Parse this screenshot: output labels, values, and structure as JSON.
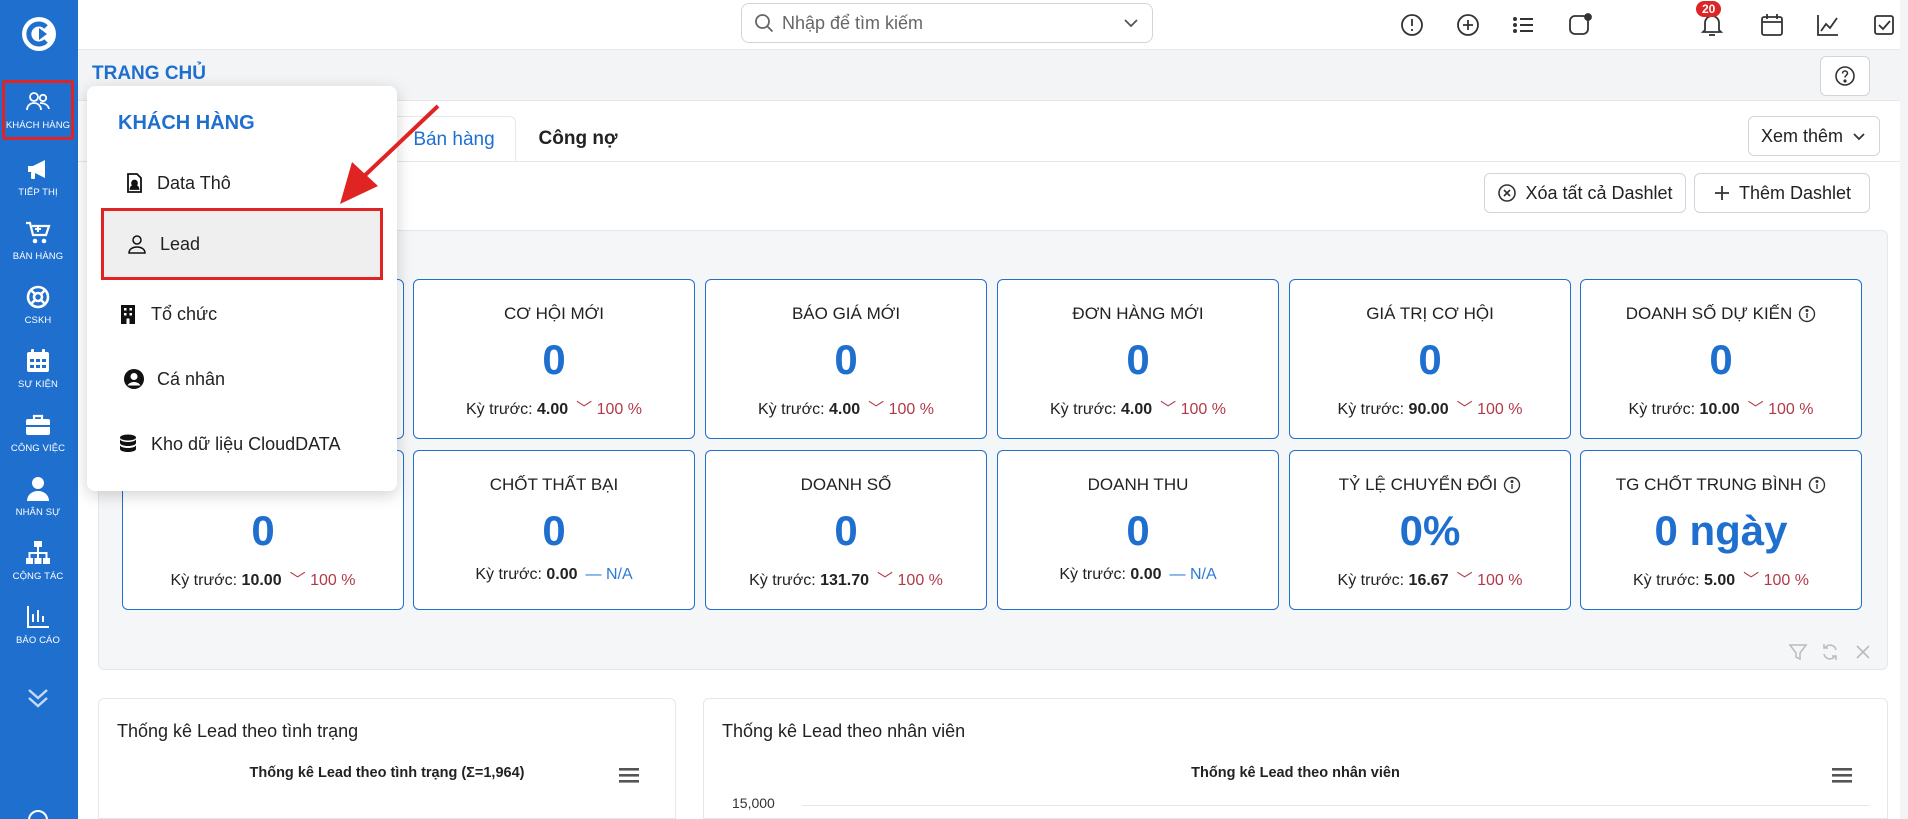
{
  "topbar": {
    "search_placeholder": "Nhập để tìm kiếm",
    "notification_count": "20"
  },
  "sidebar": {
    "items": [
      {
        "label": "Khách hàng",
        "icon": "users-icon"
      },
      {
        "label": "Tiếp thị",
        "icon": "megaphone-icon"
      },
      {
        "label": "Bán hàng",
        "icon": "cart-icon"
      },
      {
        "label": "CSKH",
        "icon": "lifebuoy-icon"
      },
      {
        "label": "Sự kiện",
        "icon": "calendar-icon"
      },
      {
        "label": "Công việc",
        "icon": "briefcase-icon"
      },
      {
        "label": "Nhân sự",
        "icon": "person-icon"
      },
      {
        "label": "Cộng tác",
        "icon": "org-chart-icon"
      },
      {
        "label": "Báo cáo",
        "icon": "bar-chart-icon"
      }
    ]
  },
  "header": {
    "title": "TRANG CHỦ"
  },
  "tabs": [
    {
      "label": "Bán hàng",
      "active": true
    },
    {
      "label": "Công nợ",
      "active": false
    }
  ],
  "toolbar": {
    "more_label": "Xem thêm",
    "clear_dashlets_label": "Xóa tất cả Dashlet",
    "add_dashlet_label": "Thêm Dashlet"
  },
  "kpis": {
    "prev_label": "Kỳ trước:",
    "row1": [
      {
        "label": "",
        "value": "",
        "prev": "",
        "change": ""
      },
      {
        "label": "CƠ HỘI MỚI",
        "value": "0",
        "prev": "4.00",
        "change": "100 %"
      },
      {
        "label": "BÁO GIÁ MỚI",
        "value": "0",
        "prev": "4.00",
        "change": "100 %"
      },
      {
        "label": "ĐƠN HÀNG MỚI",
        "value": "0",
        "prev": "4.00",
        "change": "100 %"
      },
      {
        "label": "GIÁ TRỊ CƠ HỘI",
        "value": "0",
        "prev": "90.00",
        "change": "100 %"
      },
      {
        "label": "DOANH SỐ DỰ KIẾN",
        "value": "0",
        "prev": "10.00",
        "change": "100 %"
      }
    ],
    "row2": [
      {
        "label": "",
        "value": "0",
        "prev": "10.00",
        "change": "100 %"
      },
      {
        "label": "CHỐT THẤT BẠI",
        "value": "0",
        "prev": "0.00",
        "change": "N/A"
      },
      {
        "label": "DOANH SỐ",
        "value": "0",
        "prev": "131.70",
        "change": "100 %"
      },
      {
        "label": "DOANH THU",
        "value": "0",
        "prev": "0.00",
        "change": "N/A"
      },
      {
        "label": "TỶ LỆ CHUYỂN ĐỔI",
        "value": "0%",
        "prev": "16.67",
        "change": "100 %"
      },
      {
        "label": "TG CHỐT TRUNG BÌNH",
        "value": "0 ngày",
        "prev": "5.00",
        "change": "100 %"
      }
    ]
  },
  "widgets": {
    "status": {
      "title": "Thống kê Lead theo tình trạng",
      "chart_title": "Thống kê Lead theo tình trạng (Σ=1,964)"
    },
    "staff": {
      "title": "Thống kê Lead theo nhân viên",
      "chart_title": "Thống kê Lead theo nhân viên",
      "ytick": "15,000"
    }
  },
  "dropdown": {
    "title": "KHÁCH HÀNG",
    "items": [
      {
        "label": "Data Thô",
        "icon": "contact-card-icon"
      },
      {
        "label": "Lead",
        "icon": "person-outline-icon"
      },
      {
        "label": "Tổ chức",
        "icon": "building-icon"
      },
      {
        "label": "Cá nhân",
        "icon": "user-circle-icon"
      },
      {
        "label": "Kho dữ liệu CloudDATA",
        "icon": "database-icon"
      }
    ]
  },
  "colors": {
    "primary": "#1f6fcf",
    "highlight": "#e02424",
    "negative": "#b23a48"
  }
}
